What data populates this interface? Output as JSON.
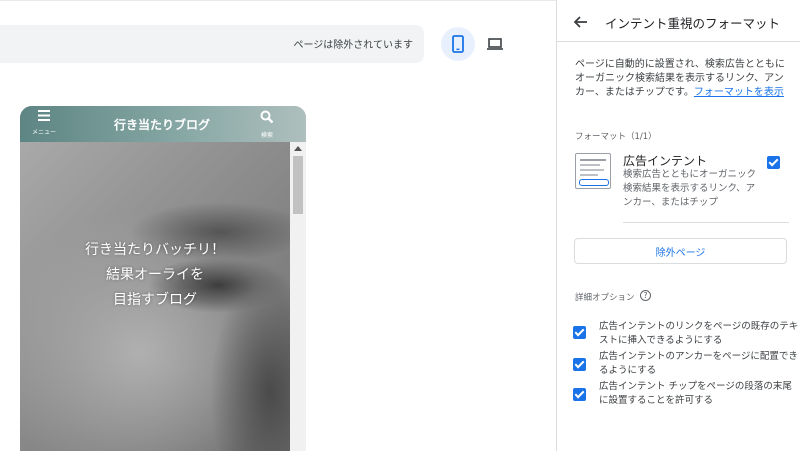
{
  "preview": {
    "excluded_text": "ページは除外されています",
    "device_mobile_icon": "smartphone-icon",
    "device_desktop_icon": "laptop-icon",
    "blog": {
      "menu_label": "メニュー",
      "title": "行き当たりブログ",
      "search_label": "検索",
      "hero_lines": [
        "行き当たりバッチリ！",
        "結果オーライを",
        "目指すブログ"
      ]
    }
  },
  "panel": {
    "title": "インテント重視のフォーマット",
    "description": "ページに自動的に設置され、検索広告とともにオーガニック検索結果を表示するリンク、アンカー、またはチップです。",
    "description_link": "フォーマットを表示",
    "format_section_label": "フォーマット（1/1）",
    "format_name": "広告インテント",
    "format_desc": "検索広告とともにオーガニック検索結果を表示するリンク、アンカー、またはチップ",
    "format_checked": true,
    "excluded_pages_button": "除外ページ",
    "advanced_label": "詳細オプション",
    "options": [
      {
        "label": "広告インテントのリンクをページの既存のテキストに挿入できるようにする",
        "checked": true
      },
      {
        "label": "広告インテントのアンカーをページに配置できるようにする",
        "checked": true
      },
      {
        "label": "広告インテント チップをページの段落の末尾に設置することを許可する",
        "checked": true
      }
    ]
  },
  "colors": {
    "accent": "#1a73e8",
    "mobile_selected_bg": "#e8f0fe",
    "header_teal": "#6f9693"
  }
}
